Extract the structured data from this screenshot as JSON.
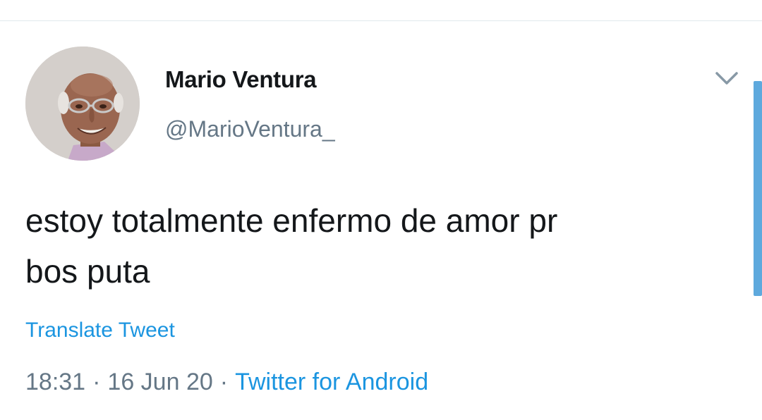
{
  "tweet": {
    "author": {
      "display_name": "Mario Ventura",
      "handle": "@MarioVentura_"
    },
    "text_line1": "estoy totalmente enfermo de amor pr",
    "text_line2": "bos puta",
    "translate_label": "Translate Tweet",
    "meta": {
      "time": "18:31",
      "separator": "·",
      "date": "16 Jun 20",
      "source": "Twitter for Android"
    },
    "menu_icon": "chevron-down-icon"
  },
  "colors": {
    "text_primary": "#14171a",
    "text_secondary": "#657786",
    "link": "#1b95e0",
    "scrollbar": "#5ea9dd",
    "divider": "#e1e8ed"
  }
}
